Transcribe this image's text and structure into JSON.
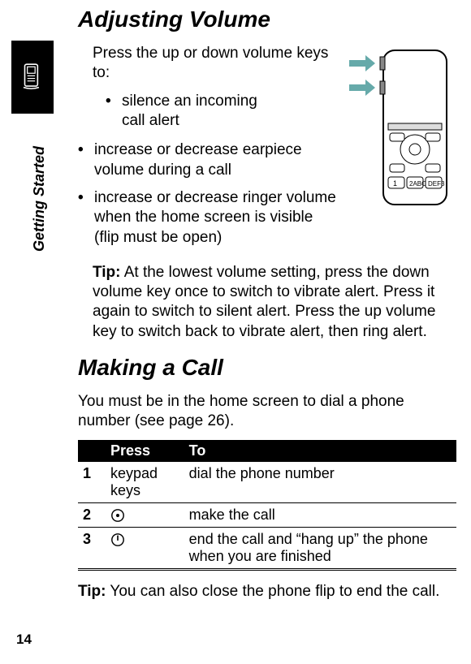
{
  "sideLabel": "Getting Started",
  "pageNumber": "14",
  "sections": {
    "adjVol": {
      "heading": "Adjusting Volume",
      "lead": "Press the up or down volume keys to:",
      "bullets": {
        "b1": "silence an incoming call alert",
        "b2": "increase or decrease earpiece volume during a call",
        "b3": "increase or decrease ringer volume when the home screen is visible (flip must be open)"
      },
      "tipLabel": "Tip:",
      "tipBody": " At the lowest volume setting, press the down volume key once to switch to vibrate alert. Press it again to switch to silent alert. Press the up volume key to switch back to vibrate alert, then ring alert."
    },
    "makeCall": {
      "heading": "Making a Call",
      "lead": "You must be in the home screen to dial a phone number (see page 26).",
      "table": {
        "hPress": "Press",
        "hTo": "To",
        "rows": {
          "r1": {
            "n": "1",
            "press": "keypad keys",
            "to": "dial the phone number"
          },
          "r2": {
            "n": "2",
            "press": "",
            "to": "make the call"
          },
          "r3": {
            "n": "3",
            "press": "",
            "to": "end the call and “hang up” the phone when you are finished"
          }
        }
      },
      "tipLabel": "Tip:",
      "tipBody": " You can also close the phone flip to end the call."
    }
  },
  "icons": {
    "phoneTab": "phone-side-icon",
    "sendKey": "send-key-icon",
    "endKey": "end-key-icon",
    "flipPhone": "flip-phone-illustration"
  }
}
